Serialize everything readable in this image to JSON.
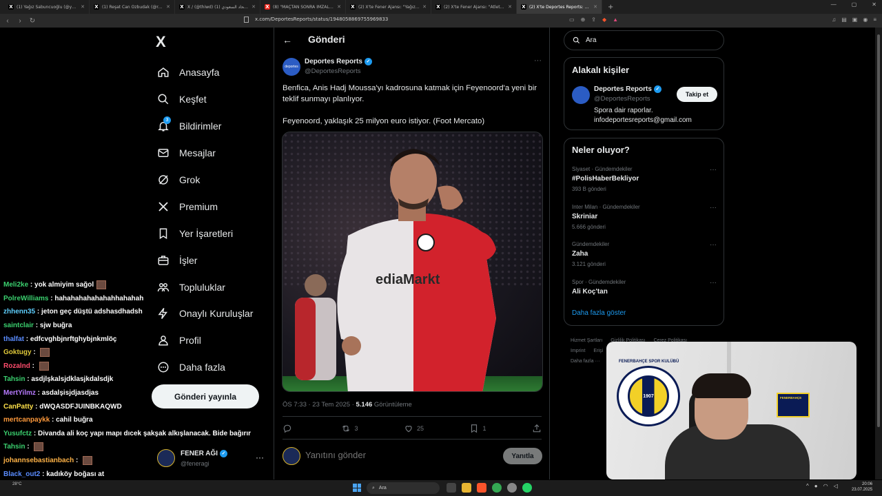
{
  "browser": {
    "tabs": [
      {
        "title": "(1) Yağız Sabuncuoğlu (@yagosabun",
        "active": false,
        "color": "#000000"
      },
      {
        "title": "(1) Reşat Can Özbudak (@resatcan_",
        "active": false,
        "color": "#000000"
      },
      {
        "title": "X / (@thiwd) نادي الاتحاد السعودي (1)",
        "active": false,
        "color": "#000000"
      },
      {
        "title": "(8) \"MAÇTAN SONRA İMZALAR ATIL",
        "active": false,
        "color": "#e62117"
      },
      {
        "title": "(2) X'te Fener Ajansı: \"Yağız Sabun",
        "active": false,
        "color": "#000000"
      },
      {
        "title": "(2) X'te Fener Ajansı: \"Atletico Mad",
        "active": false,
        "color": "#000000"
      },
      {
        "title": "(2) X'te Deportes Reports: \"Benfi",
        "active": true,
        "color": "#000000"
      }
    ],
    "url": "x.com/DeportesReports/status/1948058869755969833"
  },
  "nav": {
    "logo": "X",
    "items": [
      {
        "label": "Anasayfa",
        "icon": "home-icon"
      },
      {
        "label": "Keşfet",
        "icon": "search-icon"
      },
      {
        "label": "Bildirimler",
        "icon": "bell-icon",
        "badge": "3"
      },
      {
        "label": "Mesajlar",
        "icon": "mail-icon"
      },
      {
        "label": "Grok",
        "icon": "grok-icon"
      },
      {
        "label": "Premium",
        "icon": "x-premium-icon"
      },
      {
        "label": "Yer İşaretleri",
        "icon": "bookmark-icon"
      },
      {
        "label": "İşler",
        "icon": "briefcase-icon"
      },
      {
        "label": "Topluluklar",
        "icon": "communities-icon"
      },
      {
        "label": "Onaylı Kuruluşlar",
        "icon": "lightning-icon"
      },
      {
        "label": "Profil",
        "icon": "person-icon"
      },
      {
        "label": "Daha fazla",
        "icon": "more-circle-icon"
      }
    ],
    "post_button": "Gönderi yayınla",
    "account": {
      "name": "FENER AĞI",
      "handle": "@feneragi",
      "more": "···"
    }
  },
  "tweet": {
    "header_title": "Gönderi",
    "author_name": "Deportes Reports",
    "author_handle": "@DeportesReports",
    "avatar_text": "deportes",
    "more": "···",
    "text_1": "Benfica, Anis Hadj Moussa'yı kadrosuna katmak için Feyenoord'a yeni bir teklif sunmayı planlıyor.",
    "text_2": "Feyenoord, yaklaşık 25 milyon euro istiyor. (Foot Mercato)",
    "time": "ÖS 7:33 · 23 Tem 2025 · ",
    "views": "5.146",
    "views_label": " Görüntüleme",
    "actions": {
      "reply": "",
      "retweet": "3",
      "like": "25",
      "bookmark": "1"
    },
    "reply_placeholder": "Yanıtını gönder",
    "reply_button": "Yanıtla"
  },
  "right": {
    "search_placeholder": "Ara",
    "relevant_title": "Alakalı kişiler",
    "person": {
      "name": "Deportes Reports",
      "handle": "@DeportesReports",
      "bio_1": "Spora dair raporlar.",
      "bio_2": "infodeportesreports@gmail.com",
      "follow": "Takip et"
    },
    "trends_title": "Neler oluyor?",
    "trends": [
      {
        "cat": "Siyaset · Gündemdekiler",
        "name": "#PolisHaberBekliyor",
        "count": "393 B gönderi"
      },
      {
        "cat": "Inter Milan · Gündemdekiler",
        "name": "Skriniar",
        "count": "5.666 gönderi"
      },
      {
        "cat": "Gündemdekiler",
        "name": "Zaha",
        "count": "3.121 gönderi"
      },
      {
        "cat": "Spor · Gündemdekiler",
        "name": "Ali Koç'tan",
        "count": ""
      }
    ],
    "show_more": "Daha fazla göster",
    "footer": [
      "Hizmet Şartları",
      "Gizlilik Politikası",
      "Çerez Politikası",
      "Imprint",
      "Erişi",
      "Daha fazla ···"
    ]
  },
  "chat": [
    {
      "user": "Meli2ke",
      "color": "#3bd16f",
      "msg": "yok almiyim sağol",
      "emote": true
    },
    {
      "user": "PolreWilliams",
      "color": "#3bd16f",
      "msg": "hahahahahahahahhahahah",
      "emote": false
    },
    {
      "user": "zhhenn35",
      "color": "#5fd0ff",
      "msg": "jeton geç düştü adshasdhadsh",
      "emote": false
    },
    {
      "user": "saintclair",
      "color": "#3bd16f",
      "msg": "sjw buğra",
      "emote": false
    },
    {
      "user": "thalfat",
      "color": "#5a8cff",
      "msg": "edfcvghbjnrftghybjnkmlöç",
      "emote": false
    },
    {
      "user": "Goktugy",
      "color": "#e0c93a",
      "msg": "",
      "emote": true
    },
    {
      "user": "Rozalnd",
      "color": "#ff4d6d",
      "msg": "",
      "emote": true
    },
    {
      "user": "Tahsin",
      "color": "#3bd16f",
      "msg": "asdjlşkalsjdklasjkdalsdjk",
      "emote": false
    },
    {
      "user": "MertYilmz",
      "color": "#b77aff",
      "msg": "asdalşisjdjasdjas",
      "emote": false
    },
    {
      "user": "CanPatty",
      "color": "#ffe14a",
      "msg": "dWQASDFJUINBKAQWD",
      "emote": false
    },
    {
      "user": "mertcanpaykk",
      "color": "#ff9a3c",
      "msg": "cahil buğra",
      "emote": false
    },
    {
      "user": "Yusufctz",
      "color": "#3bd16f",
      "msg": "Divanda ali koç yapı mapı dıcek şakşak alkışlanacak. Bide bağırır",
      "emote": false
    },
    {
      "user": "Tahsin",
      "color": "#3bd16f",
      "msg": "",
      "emote": true
    },
    {
      "user": "johannsebastianbach",
      "color": "#ffb347",
      "msg": "",
      "emote": true
    },
    {
      "user": "Black_out2",
      "color": "#5a8cff",
      "msg": "kadıköy boğası at",
      "emote": false
    },
    {
      "user": "SverreNypan47",
      "color": "#ffffff",
      "msg": "",
      "emote": true
    }
  ],
  "webcam": {
    "logo_text": "FENERBAHÇE SPOR KULÜBÜ",
    "logo_year": "1907",
    "sign_text": "FENERBAHÇE"
  },
  "taskbar": {
    "weather": "28°C",
    "search": "Ara",
    "time": "20:06",
    "date": "23.07.2025"
  }
}
